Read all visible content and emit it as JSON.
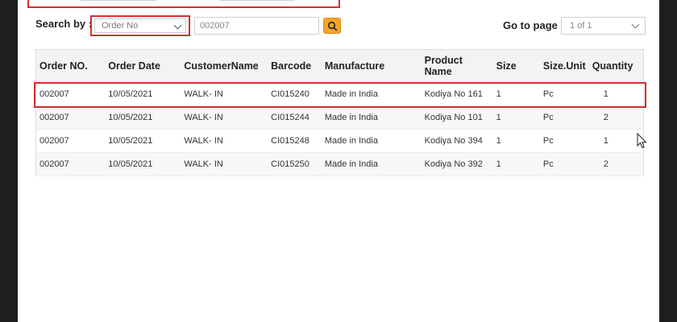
{
  "search": {
    "label": "Search by :",
    "selected_field": "Order No",
    "query": "002007"
  },
  "pager": {
    "label": "Go to page",
    "value": "1 of 1"
  },
  "table": {
    "headers": [
      "Order NO.",
      "Order Date",
      "CustomerName",
      "Barcode",
      "Manufacture",
      "Product Name",
      "Size",
      "Size.Unit",
      "Quantity"
    ],
    "rows": [
      [
        "002007",
        "10/05/2021",
        "WALK- IN",
        "CI015240",
        "Made in India",
        "Kodiya No 161",
        "1",
        "Pc",
        "1"
      ],
      [
        "002007",
        "10/05/2021",
        "WALK- IN",
        "CI015244",
        "Made in India",
        "Kodiya No 101",
        "1",
        "Pc",
        "2"
      ],
      [
        "002007",
        "10/05/2021",
        "WALK- IN",
        "CI015248",
        "Made in India",
        "Kodiya No 394",
        "1",
        "Pc",
        "1"
      ],
      [
        "002007",
        "10/05/2021",
        "WALK- IN",
        "CI015250",
        "Made in India",
        "Kodiya No 392",
        "1",
        "Pc",
        "2"
      ]
    ]
  },
  "icons": {
    "search_button": "magnifier-icon",
    "calendar": "calendar-icon",
    "cursor": "mouse-pointer-icon"
  },
  "colors": {
    "highlight": "#d32f2f",
    "accent": "#f4a52a",
    "background": "#1e1e1e"
  }
}
